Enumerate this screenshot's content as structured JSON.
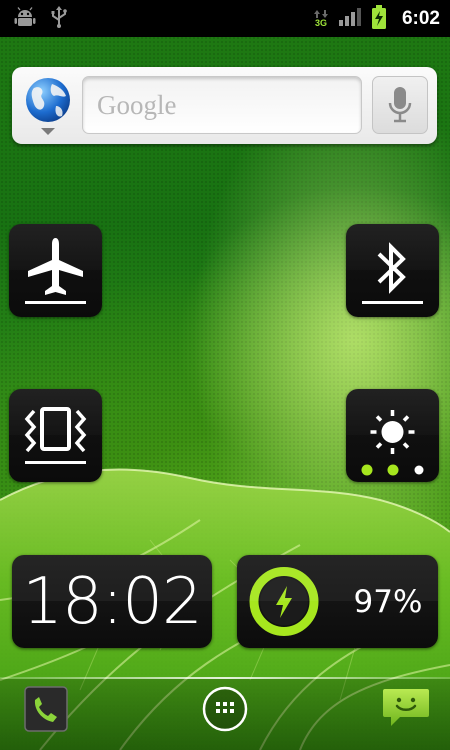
{
  "status_bar": {
    "time": "6:02",
    "network_type": "3G",
    "signal_level": 0.75,
    "battery_charging": true,
    "notification_icons": [
      "android-debug-icon",
      "usb-icon"
    ]
  },
  "search_widget": {
    "placeholder": "Google",
    "left_icon": "globe-icon",
    "right_icon": "microphone-icon"
  },
  "toggles": {
    "airplane": {
      "icon": "airplane-icon",
      "enabled": false
    },
    "bluetooth": {
      "icon": "bluetooth-icon",
      "enabled": false
    },
    "vibrate": {
      "icon": "vibrate-icon",
      "enabled": false
    },
    "brightness": {
      "icon": "brightness-icon",
      "level_dots": 3,
      "level_active": 2
    }
  },
  "clock_widget": {
    "time": "18:02"
  },
  "battery_widget": {
    "percent": "97%",
    "icon": "charging-bolt-icon"
  },
  "dock": {
    "items": [
      "phone-icon",
      "app-drawer-icon",
      "messaging-icon"
    ]
  },
  "colors": {
    "accent_green": "#a6e61e",
    "status_network": "#9fe33a",
    "tile_background": "#111111"
  }
}
